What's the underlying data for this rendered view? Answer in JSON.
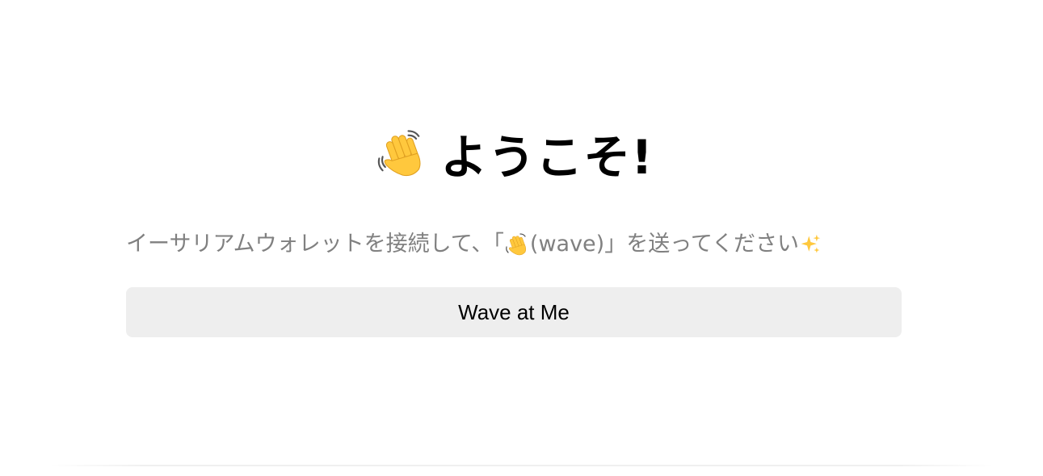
{
  "header": {
    "emoji_icon": "waving-hand-icon",
    "title": "ようこそ!"
  },
  "subtitle": {
    "text_before": "イーサリアムウォレットを接続して、「",
    "emoji_icon": "waving-hand-icon",
    "text_after": "(wave)」を送ってください",
    "trailing_icon": "sparkles-icon"
  },
  "wave_button": {
    "label": "Wave at Me"
  },
  "colors": {
    "button_bg": "#eeeeee",
    "subtitle": "#808080",
    "emoji_yellow": "#FFC83D"
  }
}
